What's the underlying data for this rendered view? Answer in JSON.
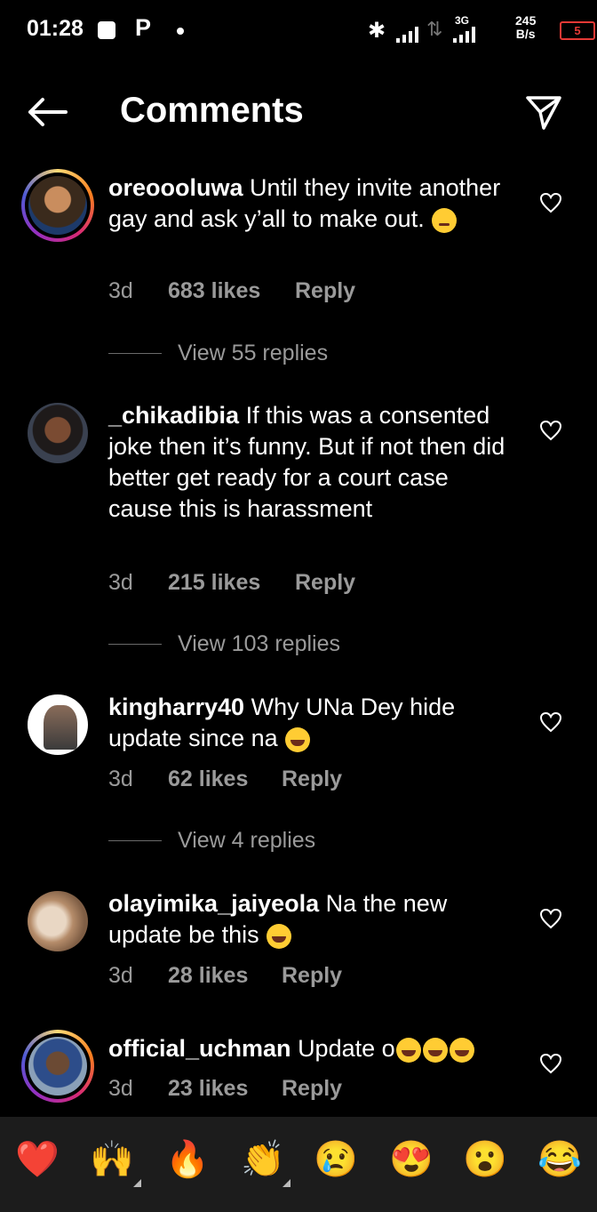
{
  "status_bar": {
    "time": "01:28",
    "app_icon": "P",
    "network": "3G",
    "speed_value": "245",
    "speed_unit": "B/s",
    "battery": "5"
  },
  "header": {
    "title": "Comments"
  },
  "comments": [
    {
      "username": "oreoooluwa",
      "text": "Until they invite another gay and ask y’all to make out.",
      "emoji": "raised-eyebrow",
      "time": "3d",
      "likes": "683 likes",
      "reply": "Reply",
      "view_replies": "View 55 replies"
    },
    {
      "username": "_chikadibia",
      "text": "If this was a consented joke then it’s funny. But if not then did better get ready for a court case cause this is harassment",
      "time": "3d",
      "likes": "215 likes",
      "reply": "Reply",
      "view_replies": "View 103 replies"
    },
    {
      "username": "kingharry40",
      "text": "Why UNa Dey hide update since na",
      "emoji": "tears-of-joy",
      "time": "3d",
      "likes": "62 likes",
      "reply": "Reply",
      "view_replies": "View 4 replies"
    },
    {
      "username": "olayimika_jaiyeola",
      "text": "Na the new update be this",
      "emoji": "tears-of-joy",
      "time": "3d",
      "likes": "28 likes",
      "reply": "Reply"
    },
    {
      "username": "official_uchman",
      "text": "Update o",
      "emoji": "tears-of-joy x3",
      "time": "3d",
      "likes": "23 likes",
      "reply": "Reply"
    }
  ],
  "reactions": [
    "❤️",
    "🙌",
    "🔥",
    "👏",
    "😢",
    "😍",
    "😮",
    "😂"
  ],
  "colors": {
    "background": "#000000",
    "secondary_text": "#9a9a9a",
    "reaction_bar": "#1c1c1c",
    "battery_low": "#e53935"
  }
}
